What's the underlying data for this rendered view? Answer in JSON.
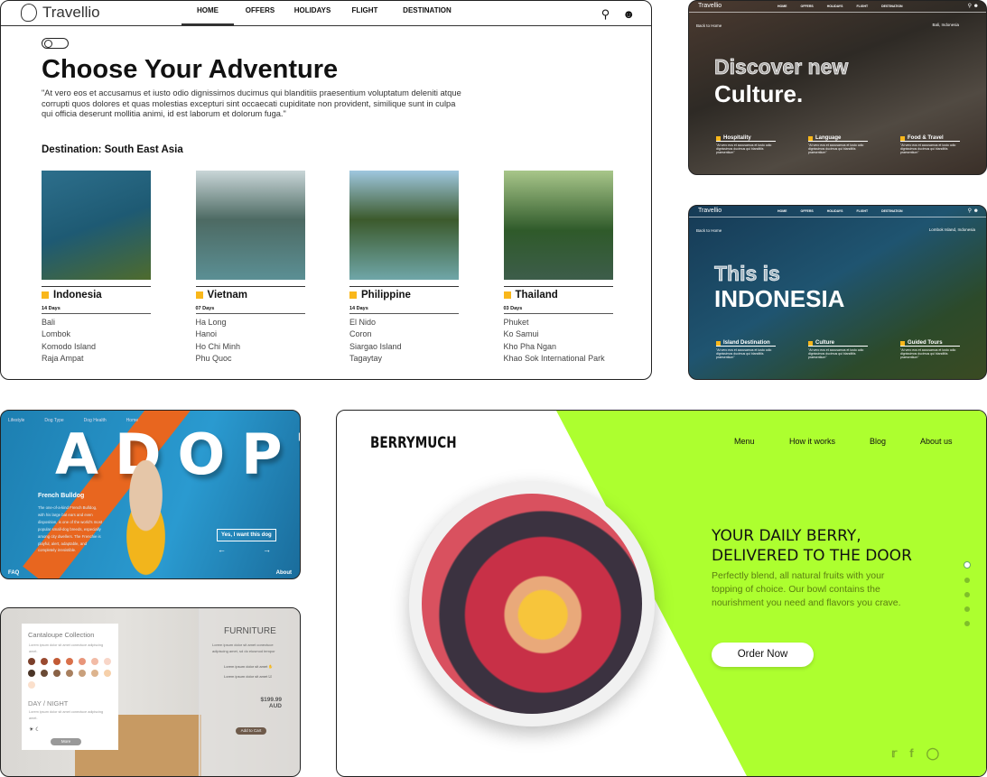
{
  "travellio": {
    "brand": "Travellio",
    "nav": [
      "HOME",
      "OFFERS",
      "HOLIDAYS",
      "FLIGHT",
      "DESTINATION"
    ],
    "title": "Choose Your Adventure",
    "intro": "\"At vero eos et accusamus et iusto odio dignissimos ducimus qui blanditiis praesentium voluptatum deleniti atque corrupti quos dolores et quas molestias excepturi sint occaecati cupiditate non provident, similique sunt in culpa qui officia deserunt mollitia animi, id est laborum et dolorum fuga.\"",
    "destination": "Destination: South East Asia",
    "countries": [
      {
        "name": "Indonesia",
        "days": "14 Days",
        "places": [
          "Bali",
          "Lombok",
          "Komodo Island",
          "Raja Ampat"
        ]
      },
      {
        "name": "Vietnam",
        "days": "07 Days",
        "places": [
          "Ha Long",
          "Hanoi",
          "Ho Chi Minh",
          "Phu Quoc"
        ]
      },
      {
        "name": "Philippine",
        "days": "14 Days",
        "places": [
          "El Nido",
          "Coron",
          "Siargao Island",
          "Tagaytay"
        ]
      },
      {
        "name": "Thailand",
        "days": "03 Days",
        "places": [
          "Phuket",
          "Ko Samui",
          "Kho Pha Ngan",
          "Khao Sok International Park"
        ]
      }
    ]
  },
  "culture": {
    "brand": "Travellio",
    "back": "Back to Home",
    "location": "Bali, Indonesia",
    "line1": "Discover new",
    "line2": "Culture.",
    "features": [
      {
        "title": "Hospitality",
        "desc": "\"At vero eos et accusamus et iusto odio dignissimos ducimus qui blanditiis praesentium\""
      },
      {
        "title": "Language",
        "desc": "\"At vero eos et accusamus et iusto odio dignissimos ducimus qui blanditiis praesentium\""
      },
      {
        "title": "Food & Travel",
        "desc": "\"At vero eos et accusamus et iusto odio dignissimos ducimus qui blanditiis praesentium\""
      }
    ]
  },
  "indonesia": {
    "brand": "Travellio",
    "back": "Back to Home",
    "location": "Lombok Island, Indonesia",
    "line1": "This is",
    "line2": "INDONESIA",
    "features": [
      {
        "title": "Island Destination",
        "desc": "\"At vero eos et accusamus et iusto odio dignissimos ducimus qui blanditiis praesentium\""
      },
      {
        "title": "Culture",
        "desc": "\"At vero eos et accusamus et iusto odio dignissimos ducimus qui blanditiis praesentium\""
      },
      {
        "title": "Guided Tours",
        "desc": "\"At vero eos et accusamus et iusto odio dignissimos ducimus qui blanditiis praesentium\""
      }
    ]
  },
  "adopt": {
    "nav": [
      "Lifestyle",
      "Dog Type",
      "Dog Health",
      "Home"
    ],
    "title": "ADOPT",
    "breed": "French Bulldog",
    "desc": "The one-of-a-kind French Bulldog, with his large bat ears and even disposition, is one of the world's most popular small-dog breeds, especially among city dwellers. The Frenchie is playful, alert, adaptable, and completely irresistible.",
    "cta": "Yes, I want this dog",
    "faq": "FAQ",
    "about": "About"
  },
  "furniture": {
    "collection": "Cantaloupe Collection",
    "collection_desc": "Lorem ipsum dolor sit amet conectuce adipiscing amet.",
    "swatches": [
      "#7b3f2a",
      "#9a4a30",
      "#c25a35",
      "#d9704a",
      "#e8957a",
      "#f2bba6",
      "#f8d6c8",
      "#4a3527",
      "#6a4a35",
      "#8a6246",
      "#a8805f",
      "#c9a07c",
      "#ddb48e",
      "#f6d0aa",
      "#fbe0cc"
    ],
    "daynight": "DAY / NIGHT",
    "daynight_desc": "Lorem ipsum dolor sit amet conectuce adipiscing amet.",
    "more": "More",
    "title": "FURNITURE",
    "desc": "Lorem ipsum dolor sit amet conectuce adipiscing amet, sd do eiusmod tempor",
    "items": [
      "Lorem ipsum dolor sit amet",
      "Lorem ipsum dolor sit amet"
    ],
    "price": "$199.99",
    "currency": "AUD",
    "cart": "Add to Cart"
  },
  "berry": {
    "brand": "BERRYMUCH",
    "nav": [
      "Menu",
      "How it works",
      "Blog",
      "About us"
    ],
    "headline1": "YOUR DAILY BERRY,",
    "headline2": "DELIVERED TO THE DOOR",
    "sub": "Perfectly blend, all natural fruits with your topping of choice. Our bowl contains the nourishment you need and flavors you crave.",
    "cta": "Order Now",
    "accent": "#adff2f",
    "slide_active": 1,
    "slide_count": 5
  }
}
